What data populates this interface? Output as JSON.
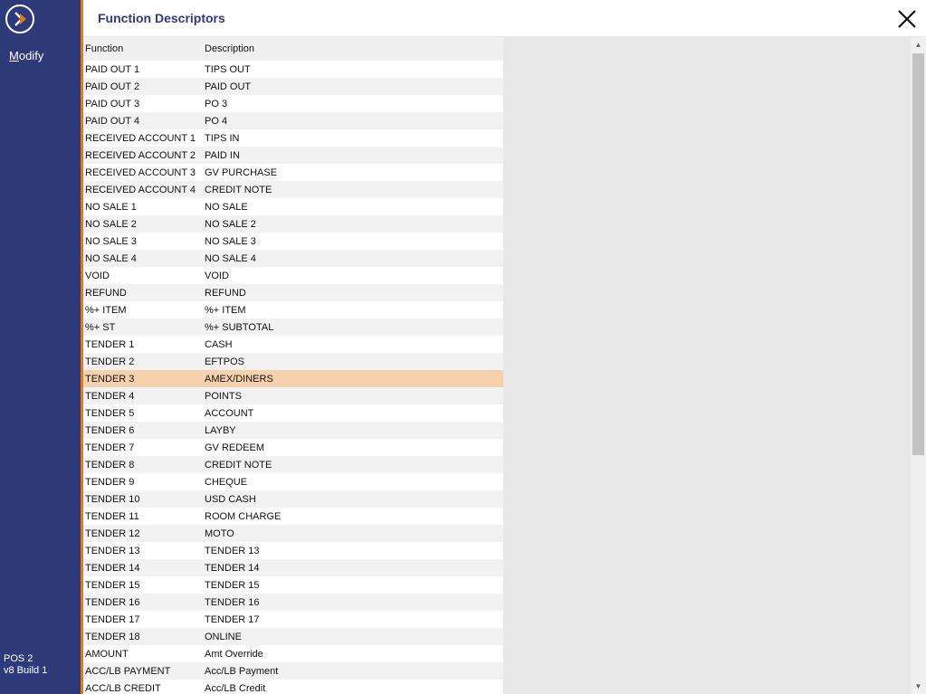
{
  "sidebar": {
    "modify_label": "Modify",
    "terminal": "POS 2",
    "version": "v8 Build 1"
  },
  "header": {
    "title": "Function Descriptors"
  },
  "grid": {
    "columns": [
      "Function",
      "Description"
    ],
    "rows": [
      {
        "function": "PAID OUT 1",
        "description": "TIPS OUT"
      },
      {
        "function": "PAID OUT 2",
        "description": "PAID OUT"
      },
      {
        "function": "PAID OUT 3",
        "description": "PO 3"
      },
      {
        "function": "PAID OUT 4",
        "description": "PO 4"
      },
      {
        "function": "RECEIVED ACCOUNT 1",
        "description": "TIPS IN"
      },
      {
        "function": "RECEIVED ACCOUNT 2",
        "description": "PAID IN"
      },
      {
        "function": "RECEIVED ACCOUNT 3",
        "description": "GV PURCHASE"
      },
      {
        "function": "RECEIVED ACCOUNT 4",
        "description": "CREDIT NOTE"
      },
      {
        "function": "NO SALE 1",
        "description": "NO SALE"
      },
      {
        "function": "NO SALE 2",
        "description": "NO SALE 2"
      },
      {
        "function": "NO SALE 3",
        "description": "NO SALE 3"
      },
      {
        "function": "NO SALE 4",
        "description": "NO SALE 4"
      },
      {
        "function": "VOID",
        "description": "VOID"
      },
      {
        "function": "REFUND",
        "description": "REFUND"
      },
      {
        "function": "%+ ITEM",
        "description": "%+ ITEM"
      },
      {
        "function": "%+ ST",
        "description": "%+ SUBTOTAL"
      },
      {
        "function": "TENDER 1",
        "description": "CASH"
      },
      {
        "function": "TENDER 2",
        "description": "EFTPOS"
      },
      {
        "function": "TENDER 3",
        "description": "AMEX/DINERS",
        "selected": true
      },
      {
        "function": "TENDER 4",
        "description": "POINTS"
      },
      {
        "function": "TENDER 5",
        "description": "ACCOUNT"
      },
      {
        "function": "TENDER 6",
        "description": "LAYBY"
      },
      {
        "function": "TENDER 7",
        "description": "GV REDEEM"
      },
      {
        "function": "TENDER 8",
        "description": "CREDIT NOTE"
      },
      {
        "function": "TENDER 9",
        "description": "CHEQUE"
      },
      {
        "function": "TENDER 10",
        "description": "USD CASH"
      },
      {
        "function": "TENDER 11",
        "description": "ROOM CHARGE"
      },
      {
        "function": "TENDER 12",
        "description": "MOTO"
      },
      {
        "function": "TENDER 13",
        "description": "TENDER 13"
      },
      {
        "function": "TENDER 14",
        "description": "TENDER 14"
      },
      {
        "function": "TENDER 15",
        "description": "TENDER 15"
      },
      {
        "function": "TENDER 16",
        "description": "TENDER 16"
      },
      {
        "function": "TENDER 17",
        "description": "TENDER 17"
      },
      {
        "function": "TENDER 18",
        "description": "ONLINE"
      },
      {
        "function": "AMOUNT",
        "description": "Amt Override"
      },
      {
        "function": "ACC/LB PAYMENT",
        "description": "Acc/LB Payment"
      },
      {
        "function": "ACC/LB CREDIT",
        "description": "Acc/LB Credit"
      }
    ]
  },
  "icons": {
    "logo": "play-chevron-logo-icon",
    "close": "close-icon",
    "scroll_up": "chevron-up-icon",
    "scroll_down": "chevron-down-icon"
  },
  "colors": {
    "sidebar": "#2e3a79",
    "accent": "#e07a1e",
    "selected_row": "#f5d2ad",
    "title": "#2e3a79"
  }
}
